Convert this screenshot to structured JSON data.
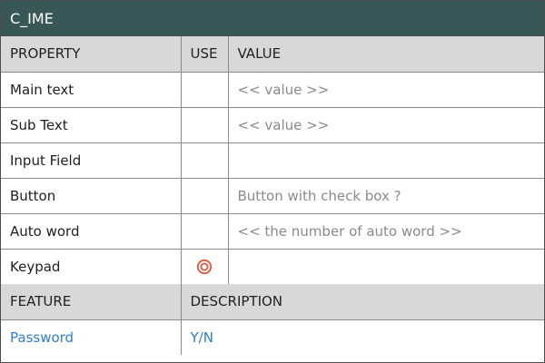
{
  "title": "C_IME",
  "property_table": {
    "headers": {
      "property": "PROPERTY",
      "use": "USE",
      "value": "VALUE"
    },
    "rows": [
      {
        "property": "Main text",
        "use_icon": "",
        "value": "<< value >>"
      },
      {
        "property": "Sub Text",
        "use_icon": "",
        "value": "<< value >>"
      },
      {
        "property": "Input Field",
        "use_icon": "",
        "value": ""
      },
      {
        "property": "Button",
        "use_icon": "",
        "value": "Button with check box ?"
      },
      {
        "property": "Auto word",
        "use_icon": "",
        "value": "<< the number of auto word >>"
      },
      {
        "property": "Keypad",
        "use_icon": "double-circle-icon",
        "value": ""
      }
    ]
  },
  "feature_table": {
    "headers": {
      "feature": "FEATURE",
      "description": "DESCRIPTION"
    },
    "rows": [
      {
        "feature": "Password",
        "description": "Y/N"
      }
    ]
  },
  "colors": {
    "title_bar": "#385757",
    "header_row": "#d8d8d8",
    "placeholder_text": "#8a8a8a",
    "accent_blue": "#2f7fc9",
    "use_icon": "#e0563a"
  }
}
